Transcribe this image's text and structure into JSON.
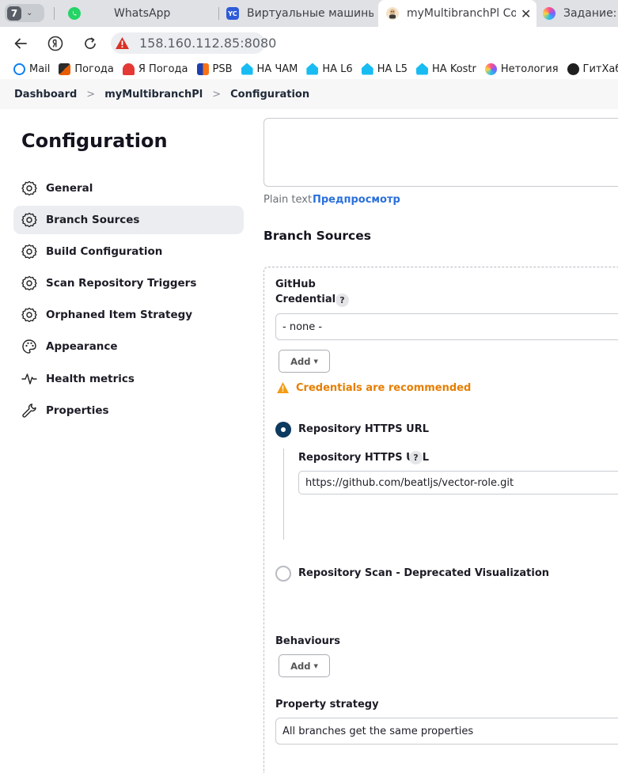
{
  "browser": {
    "tab_count": "7",
    "tabs": [
      {
        "title": "WhatsApp"
      },
      {
        "title": "Виртуальные машины | Y"
      },
      {
        "title": "myMultibranchPl Config"
      },
      {
        "title": "Задание: Д"
      }
    ],
    "yc_badge": "YC",
    "url": "158.160.112.85:8080",
    "bookmarks": [
      {
        "label": "Mail"
      },
      {
        "label": "Погода"
      },
      {
        "label": "Я Погода"
      },
      {
        "label": "PSB"
      },
      {
        "label": "НА ЧАМ"
      },
      {
        "label": "НА L6"
      },
      {
        "label": "НА L5"
      },
      {
        "label": "НА Kostr"
      },
      {
        "label": "Нетология"
      },
      {
        "label": "ГитХаб"
      }
    ]
  },
  "breadcrumb": {
    "items": [
      "Dashboard",
      "myMultibranchPl",
      "Configuration"
    ],
    "separator": ">"
  },
  "sidebar": {
    "title": "Configuration",
    "items": [
      {
        "label": "General",
        "icon": "gear-icon"
      },
      {
        "label": "Branch Sources",
        "icon": "gear-icon"
      },
      {
        "label": "Build Configuration",
        "icon": "gear-icon"
      },
      {
        "label": "Scan Repository Triggers",
        "icon": "gear-icon"
      },
      {
        "label": "Orphaned Item Strategy",
        "icon": "gear-icon"
      },
      {
        "label": "Appearance",
        "icon": "palette-icon"
      },
      {
        "label": "Health metrics",
        "icon": "pulse-icon"
      },
      {
        "label": "Properties",
        "icon": "wrench-icon"
      }
    ],
    "active_index": 1
  },
  "main": {
    "description": {
      "value": "",
      "plain_text_label": "Plain text",
      "preview_label": "Предпросмотр"
    },
    "branch_sources": {
      "title": "Branch Sources",
      "source_type": "GitHub",
      "credentials_label": "Credentials",
      "credentials_value": "- none -",
      "add_button": "Add",
      "warning": "Credentials are recommended",
      "radio_https": "Repository HTTPS URL",
      "https_url_label": "Repository HTTPS URL",
      "https_url_value": "https://github.com/beatljs/vector-role.git",
      "radio_scan": "Repository Scan - Deprecated Visualization",
      "behaviours_label": "Behaviours",
      "behaviours_add": "Add",
      "property_strategy_label": "Property strategy",
      "property_strategy_value": "All branches get the same properties",
      "help_glyph": "?"
    }
  },
  "colors": {
    "accent_dark": "#0d3a5f",
    "warning": "#e67e00",
    "link": "#2a6fdb",
    "sidebar_active_bg": "#ecedf0"
  }
}
